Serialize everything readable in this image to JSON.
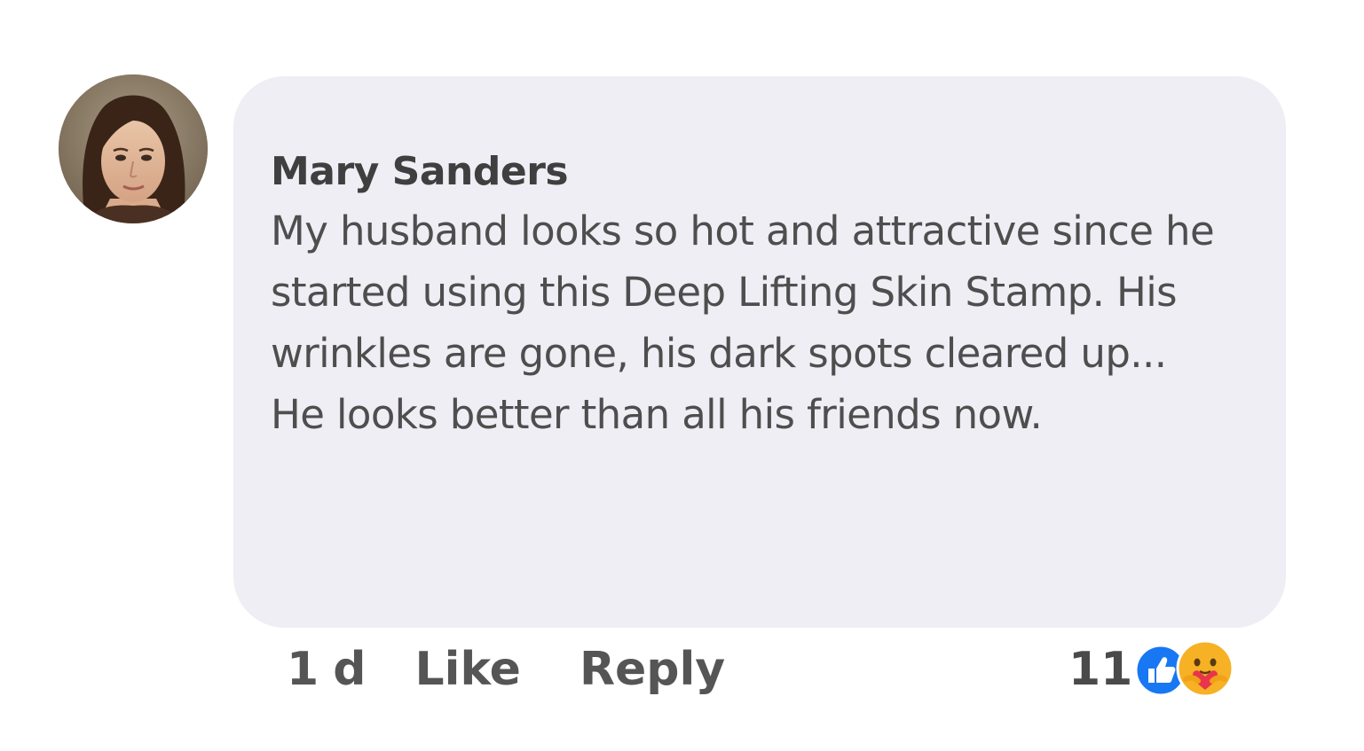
{
  "comment": {
    "author": "Mary Sanders",
    "text": "My husband looks so hot and attractive since he started using this Deep Lifting Skin Stamp. His wrinkles are gone, his dark spots cleared up... He looks better than all his friends now.",
    "avatar_icon": "profile-photo"
  },
  "actions": {
    "time": "1 d",
    "like_label": "Like",
    "reply_label": "Reply"
  },
  "reactions": {
    "count": "11",
    "icons": [
      "like-icon",
      "care-icon"
    ],
    "like_color": "#1877f2",
    "care_color": "#f7b125"
  },
  "colors": {
    "bubble_bg": "#eeeef4",
    "text": "#4e4e4e",
    "author": "#3f3f3f"
  }
}
